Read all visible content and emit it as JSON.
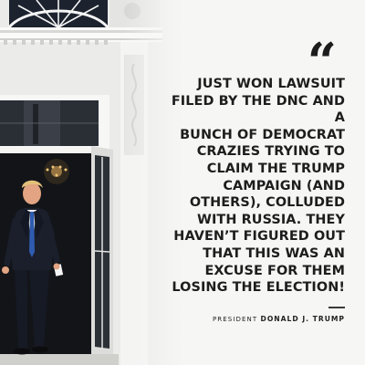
{
  "quote": {
    "mark": "“",
    "text": "JUST WON LAWSUIT\nFILED BY THE DNC AND A\nBUNCH OF DEMOCRAT\nCRAZIES TRYING TO\nCLAIM THE TRUMP\nCAMPAIGN (AND\nOTHERS), COLLUDED\nWITH RUSSIA. THEY\nHAVEN’T FIGURED OUT\nTHAT THIS WAS AN\nEXCUSE FOR THEM\nLOSING THE ELECTION!"
  },
  "attribution": {
    "title": "PRESIDENT",
    "name": "DONALD J. TRUMP"
  },
  "colors": {
    "text": "#1d1d1d",
    "background": "#f6f6f5",
    "suit": "#1a1f2b",
    "tie": "#2f5bb0",
    "building": "#f2f2f1"
  }
}
